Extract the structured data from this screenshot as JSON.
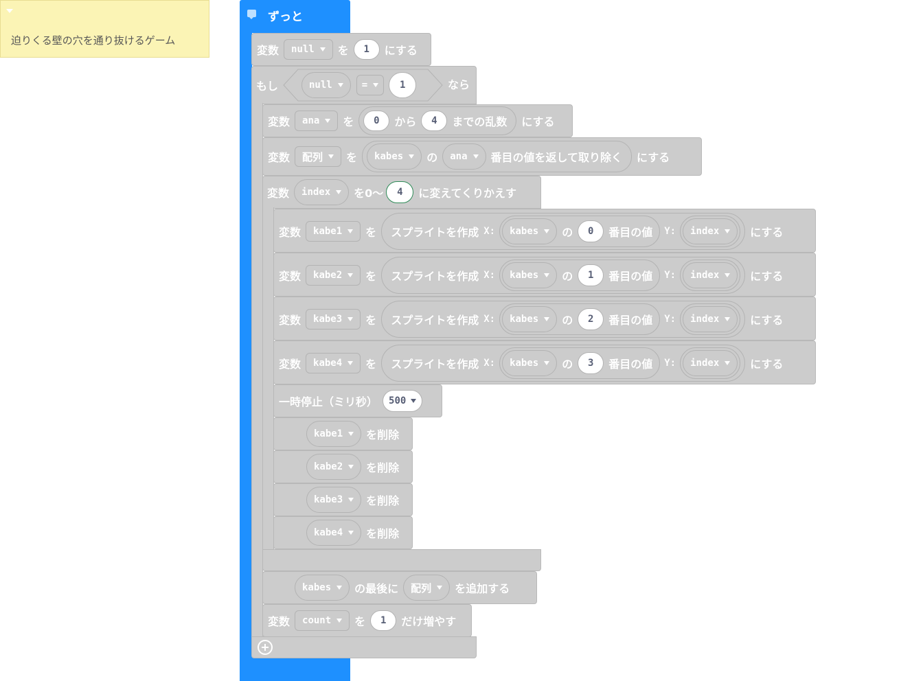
{
  "comment": {
    "text": "迫りくる壁の穴を通り抜けるゲーム"
  },
  "forever": {
    "label": "ずっと"
  },
  "words": {
    "variable": "変数",
    "wo": "を",
    "ni_suru": "にする",
    "moshi": "もし",
    "nara": "なら",
    "kara": "から",
    "made_no_ransu": "までの乱数",
    "no": "の",
    "pop_index": "番目の値を返して取り除く",
    "repeat_prefix": "を0〜",
    "repeat_suffix": "に変えてくりかえす",
    "create_sprite": "スプライトを作成",
    "x": "X:",
    "y": "Y:",
    "nth_value": "番目の値",
    "pause": "一時停止（ミリ秒）",
    "delete": "を削除",
    "push_mid": "の最後に",
    "push_end": "を追加する",
    "change_by": "だけ増やす"
  },
  "blocks": {
    "set_null": {
      "var": "null",
      "value": "1"
    },
    "if_cond": {
      "var": "null",
      "op": "=",
      "value": "1"
    },
    "set_ana": {
      "var": "ana",
      "from": "0",
      "to": "4"
    },
    "set_array": {
      "var": "配列",
      "list": "kabes",
      "index_var": "ana"
    },
    "repeat": {
      "var": "index",
      "count": "4"
    },
    "sprites": [
      {
        "var": "kabe1",
        "list": "kabes",
        "n": "0",
        "y": "index"
      },
      {
        "var": "kabe2",
        "list": "kabes",
        "n": "1",
        "y": "index"
      },
      {
        "var": "kabe3",
        "list": "kabes",
        "n": "2",
        "y": "index"
      },
      {
        "var": "kabe4",
        "list": "kabes",
        "n": "3",
        "y": "index"
      }
    ],
    "pause": {
      "value": "500"
    },
    "deletes": [
      "kabe1",
      "kabe2",
      "kabe3",
      "kabe4"
    ],
    "push": {
      "list": "kabes",
      "item": "配列"
    },
    "change": {
      "var": "count",
      "value": "1"
    }
  },
  "colors": {
    "forever_blue": "#1e90ff",
    "block_gray": "#cccccc",
    "comment_yellow": "#fbf4b5"
  }
}
